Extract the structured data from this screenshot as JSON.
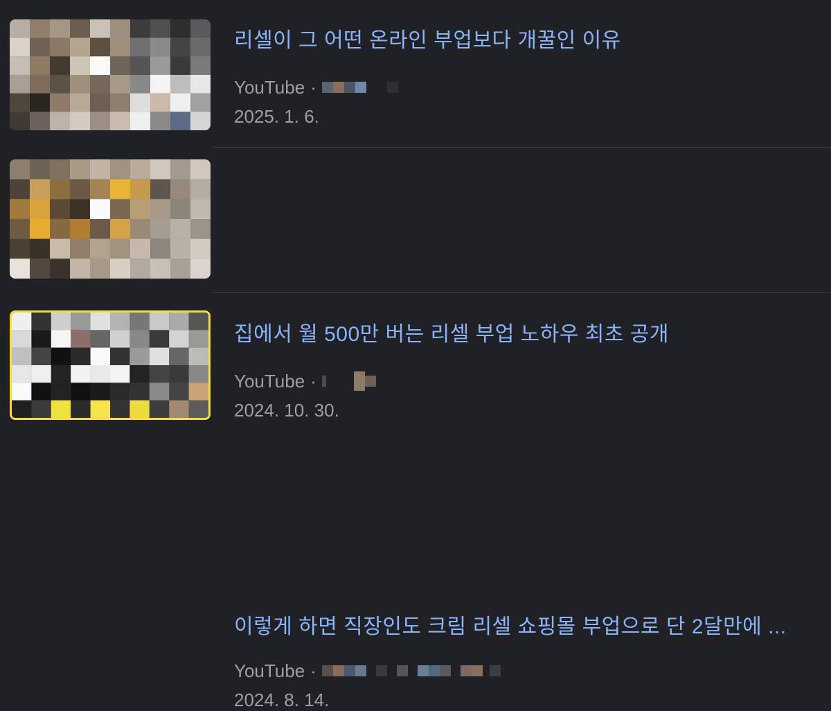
{
  "theme": {
    "background": "#202124",
    "link_color": "#8ab4f8",
    "meta_color": "#9aa0a6",
    "highlight_border": "#f7e034"
  },
  "results": [
    {
      "title": "리셀이 그 어떤 온라인 부업보다 개꿀인 이유",
      "source": "YouTube",
      "separator": "·",
      "date": "2025. 1. 6."
    },
    {
      "title": "집에서 월 500만 버는 리셀 부업 노하우 최초 공개",
      "source": "YouTube",
      "separator": "·",
      "date": "2024. 10. 30."
    },
    {
      "title": "이렇게 하면 직장인도 크림 리셀 쇼핑몰 부업으로 단 2달만에 ...",
      "source": "YouTube",
      "separator": "·",
      "date": "2024. 8. 14."
    }
  ]
}
